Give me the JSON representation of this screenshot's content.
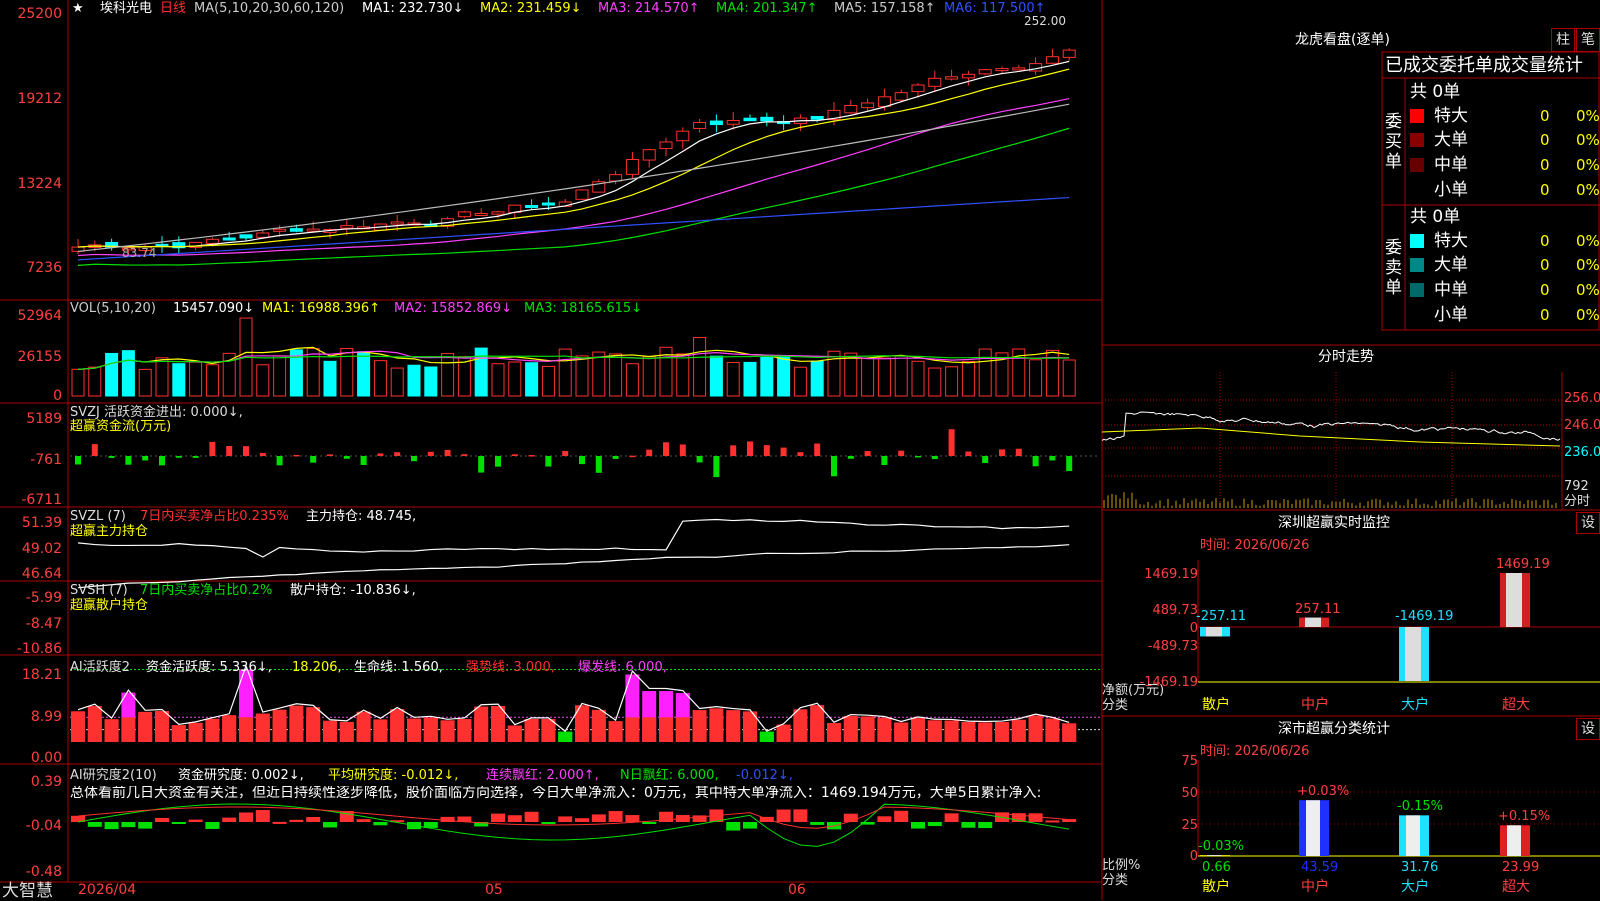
{
  "colors": {
    "up": "#ff3030",
    "down": "#00ffff",
    "green": "#00e000",
    "yellow": "#ffff00",
    "magenta": "#ff40ff",
    "frame": "#aa0000",
    "axis": "#ff4040"
  },
  "main": {
    "title_star": "★",
    "stock_name": "埃科光电",
    "period": "日线",
    "ma_spec": "MA(5,10,20,30,60,120)",
    "ma1": "MA1: 232.730↓",
    "ma2": "MA2: 231.459↓",
    "ma3": "MA3: 214.570↑",
    "ma4": "MA4: 201.347↑",
    "ma5": "MA5: 157.158↑",
    "ma6": "MA6: 117.500↑",
    "price_note": "252.00",
    "low_note": "83.74",
    "y_ticks": [
      "25200",
      "19212",
      "13224",
      "7236"
    ]
  },
  "vol": {
    "spec": "VOL(5,10,20)",
    "value": "15457.090↓",
    "ma1": "MA1: 16988.396↑",
    "ma2": "MA2: 15852.869↓",
    "ma3": "MA3: 18165.615↓",
    "y_ticks": [
      "52964",
      "26155",
      "0"
    ]
  },
  "svzj": {
    "title": "SVZJ  活跃资金进出: 0.000↓,",
    "sub": "超赢资金流(万元)",
    "y_ticks": [
      "5189",
      "-761",
      "-6711"
    ]
  },
  "svzl": {
    "spec": "SVZL (7)",
    "ratio": "7日内买卖净占比0.235%",
    "hold": "主力持仓: 48.745,",
    "sub": "超赢主力持仓",
    "y_ticks": [
      "51.39",
      "49.02",
      "46.64"
    ]
  },
  "svsh": {
    "spec": "SVSH (7)",
    "ratio": "7日内买卖净占比0.2%",
    "hold": "散户持仓: -10.836↓,",
    "sub": "超赢散户持仓",
    "y_ticks": [
      "-5.99",
      "-8.47",
      "-10.86"
    ]
  },
  "ai1": {
    "spec": "AI活跃度2",
    "v1": "资金活跃度: 5.336↓,",
    "v2": "18.206,",
    "v3": "生命线: 1.560,",
    "v4": "强势线: 3.000,",
    "v5": "爆发线: 6.000,",
    "y_ticks": [
      "18.21",
      "8.99",
      "0.00"
    ]
  },
  "ai2": {
    "spec": "AI研究度2(10)",
    "v1": "资金研究度: 0.002↓,",
    "v2": "平均研究度: -0.012↓,",
    "v3": "连续飘红: 2.000↑,",
    "v4": "N日飘红: 6.000,",
    "v5": "-0.012↓,",
    "summary": "总体看前几日大资金有关注，但近日持续性逐步降低，股价面临方向选择，今日大单净流入：0万元，其中特大单净流入：1469.194万元，大单5日累计净入:",
    "y_ticks": [
      "0.39",
      "-0.04",
      "-0.48"
    ]
  },
  "bottom": {
    "brand": "大智慧",
    "dates": [
      "2026/04",
      "05",
      "06"
    ]
  },
  "right": {
    "longhu_title": "龙虎看盘(逐单)",
    "btn_bar": "柱",
    "btn_stroke": "笔",
    "stats_title": "已成交委托单成交量统计",
    "buy_label": "委买单",
    "sell_label": "委卖单",
    "buy_total": "共 0单",
    "sell_total": "共 0单",
    "rows": [
      {
        "name": "特大",
        "count": "0",
        "pct": "0%"
      },
      {
        "name": "大单",
        "count": "0",
        "pct": "0%"
      },
      {
        "name": "中单",
        "count": "0",
        "pct": "0%"
      },
      {
        "name": "小单",
        "count": "0",
        "pct": "0%"
      }
    ],
    "intraday_title": "分时走势",
    "intraday_y": [
      "256.0",
      "246.0",
      "236.0",
      "792"
    ],
    "intraday_unit": "分时",
    "sz_title": "深圳超赢实时监控",
    "sz_btn": "设",
    "sz_date": "时间: 2026/06/26",
    "sz_y": [
      "1469.19",
      "489.73",
      "0",
      "-489.73",
      "-1469.19"
    ],
    "sz_net_label": "净额(万元)",
    "sz_class_label": "分类",
    "sz_bars": [
      {
        "cat": "散户",
        "value": -257.11,
        "label": "-257.11"
      },
      {
        "cat": "中户",
        "value": 257.11,
        "label": "257.11"
      },
      {
        "cat": "大户",
        "value": -1469.19,
        "label": "-1469.19"
      },
      {
        "cat": "超大",
        "value": 1469.19,
        "label": "1469.19"
      }
    ],
    "class_title": "深市超赢分类统计",
    "class_btn": "设",
    "class_date": "时间: 2026/06/26",
    "class_y": [
      "75",
      "50",
      "25",
      "0"
    ],
    "class_ratio_label": "比例%",
    "class_class_label": "分类",
    "class_bars": [
      {
        "cat": "散户",
        "value": 0.66,
        "change": "-0.03%"
      },
      {
        "cat": "中户",
        "value": 43.59,
        "change": "+0.03%"
      },
      {
        "cat": "大户",
        "value": 31.76,
        "change": "-0.15%"
      },
      {
        "cat": "超大",
        "value": 23.99,
        "change": "+0.15%"
      }
    ]
  }
}
